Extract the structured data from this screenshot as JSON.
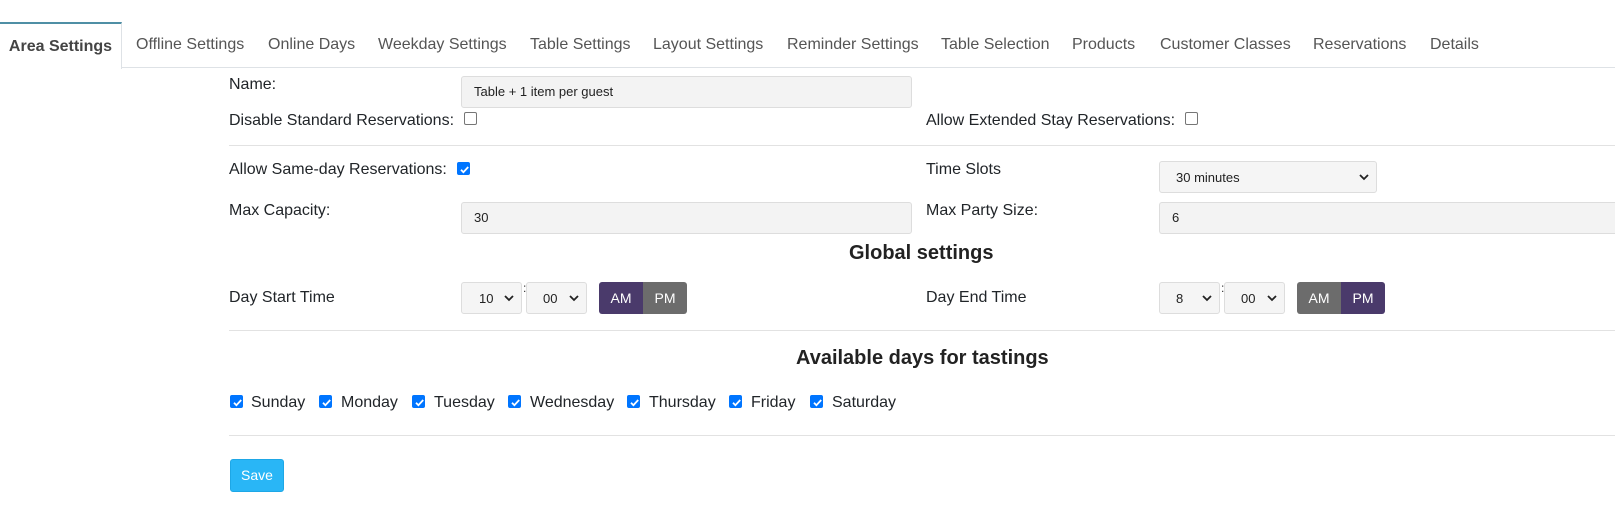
{
  "tabs": [
    {
      "label": "Area Settings",
      "active": true
    },
    {
      "label": "Offline Settings"
    },
    {
      "label": "Online Days"
    },
    {
      "label": "Weekday Settings"
    },
    {
      "label": "Table Settings"
    },
    {
      "label": "Layout Settings"
    },
    {
      "label": "Reminder Settings"
    },
    {
      "label": "Table Selection"
    },
    {
      "label": "Products"
    },
    {
      "label": "Customer Classes"
    },
    {
      "label": "Reservations"
    },
    {
      "label": "Details"
    }
  ],
  "form": {
    "name_label": "Name:",
    "name_value": "Table + 1 item per guest",
    "disable_standard_label": "Disable Standard Reservations:",
    "disable_standard_checked": false,
    "allow_extended_label": "Allow Extended Stay Reservations:",
    "allow_extended_checked": false,
    "allow_same_day_label": "Allow Same-day Reservations:",
    "allow_same_day_checked": true,
    "time_slots_label": "Time Slots",
    "time_slots_value": "30 minutes",
    "max_capacity_label": "Max Capacity:",
    "max_capacity_value": "30",
    "max_party_label": "Max Party Size:",
    "max_party_value": "6"
  },
  "global": {
    "heading": "Global settings",
    "day_start_label": "Day Start Time",
    "day_start_hour": "10",
    "day_start_minute": "00",
    "day_start_period": "AM",
    "day_end_label": "Day End Time",
    "day_end_hour": "8",
    "day_end_minute": "00",
    "day_end_period": "PM",
    "am_label": "AM",
    "pm_label": "PM",
    "colon": ":"
  },
  "days": {
    "heading": "Available days for tastings",
    "items": [
      {
        "label": "Sunday",
        "checked": true
      },
      {
        "label": "Monday",
        "checked": true
      },
      {
        "label": "Tuesday",
        "checked": true
      },
      {
        "label": "Wednesday",
        "checked": true
      },
      {
        "label": "Thursday",
        "checked": true
      },
      {
        "label": "Friday",
        "checked": true
      },
      {
        "label": "Saturday",
        "checked": true
      }
    ]
  },
  "actions": {
    "save_label": "Save"
  },
  "colors": {
    "accent_purple": "#4a3a6b",
    "segment_grey": "#6c6c6c",
    "checkbox_blue": "#0075ff",
    "save_blue": "#29b6f6",
    "active_tab_border": "#4f8fa5"
  }
}
